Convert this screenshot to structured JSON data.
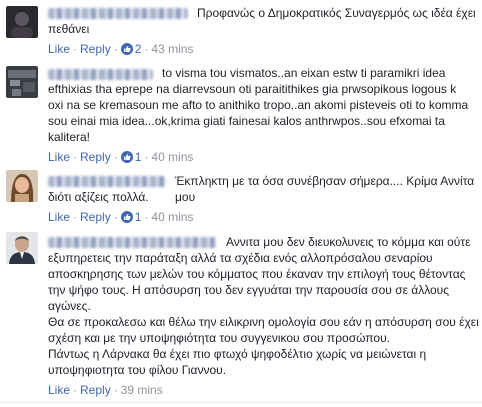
{
  "comments": [
    {
      "text": "Προφανώς ο Δημοκρατικός Συναγερμός ως ιδέα έχει πεθάνει",
      "actions": {
        "like": "Like",
        "reply": "Reply",
        "likes_count": "2",
        "time": "43 mins"
      }
    },
    {
      "text": "to visma tou vismatos..an eixan estw ti paramikri idea efthixias tha eprepe na diarrevsoun oti paraitithikes gia prwsopikous logous k oxi na se kremasoun me afto to anithiko tropo..an akomi pisteveis oti to komma sou einai mia idea...ok,krima giati fainesai kalos anthrwpos..sou efxomai ta kalitera!",
      "actions": {
        "like": "Like",
        "reply": "Reply",
        "likes_count": "1",
        "time": "40 mins"
      }
    },
    {
      "text": "Έκπληκτη με τα όσα συνέβησαν σήμερα.... Κρίμα Αννίτα μου διότι αξίζεις πολλά.",
      "actions": {
        "like": "Like",
        "reply": "Reply",
        "likes_count": "1",
        "time": "40 mins"
      }
    },
    {
      "text": "Αννιτα μου δεν διευκολυνεις το κόμμα και ούτε εξυπηρετεις την παράταξη αλλά τα σχέδια ενός αλλοπρόσαλου σεναρίου αποσκηρησης των μελών του κόμματος που έκαναν την επιλογή τους θέτοντας την ψήφο τους. Η απόσυρση του δεν εγγυάται την παρουσία σου σε άλλους αγώνες.\nΘα σε προκαλεσω και θέλω την ειλικρινη ομολογία σου εάν η απόσυρση σου έχει σχέση και με την υποψηφιότητα του συγγενικου σου προσώπου.\nΠάντως η Λάρνακα θα έχει πιο φτωχό ψηφοδέλτιο χωρίς να μειώνεται η υποψηφιοτητα του φίλου Γιαννου.",
      "actions": {
        "like": "Like",
        "reply": "Reply",
        "likes_count": "",
        "time": "39 mins"
      }
    }
  ],
  "lines": {
    "c1": [
      "Προφανώς ο Δημοκρατικός Συναγερμός ως ιδέα έχει",
      "πεθάνει"
    ],
    "c2": [
      "to visma tou vismatos..an eixan estw ti paramikri idea",
      "efthixias tha eprepe na diarrevsoun oti paraitithikes gia prwsopikous logous k",
      "oxi na se kremasoun me afto to anithiko tropo..an akomi pisteveis oti to komma",
      "sou einai mia idea...ok,krima giati fainesai kalos anthrwpos..sou efxomai ta",
      "kalitera!"
    ],
    "c3": [
      "Έκπληκτη με τα όσα συνέβησαν σήμερα.... Κρίμα Αννίτα μου",
      "διότι αξίζεις πολλά."
    ],
    "c4": [
      "Αννιτα μου δεν διευκολυνεις το κόμμα και ούτε",
      "εξυπηρετεις την παράταξη αλλά τα σχέδια ενός αλλοπρόσαλου σεναρίου",
      "αποσκηρησης των μελών του κόμματος που έκαναν την επιλογή τους θέτοντας",
      "την ψήφο τους. Η απόσυρση του δεν εγγυάται την παρουσία σου σε άλλους",
      "αγώνες.",
      "Θα σε προκαλεσω και θέλω την ειλικρινη ομολογία σου εάν η απόσυρση σου έχει",
      "σχέση και με την υποψηφιότητα του συγγενικου σου προσώπου.",
      "Πάντως η Λάρνακα θα έχει πιο φτωχό ψηφοδέλτιο χωρίς να μειώνεται η",
      "υποψηφιοτητα του φίλου Γιαννου."
    ]
  },
  "colors": {
    "link": "#4267b2",
    "meta": "#90949c",
    "text": "#1d2129"
  },
  "icons": {
    "like_badge": "thumbs-up-icon"
  }
}
